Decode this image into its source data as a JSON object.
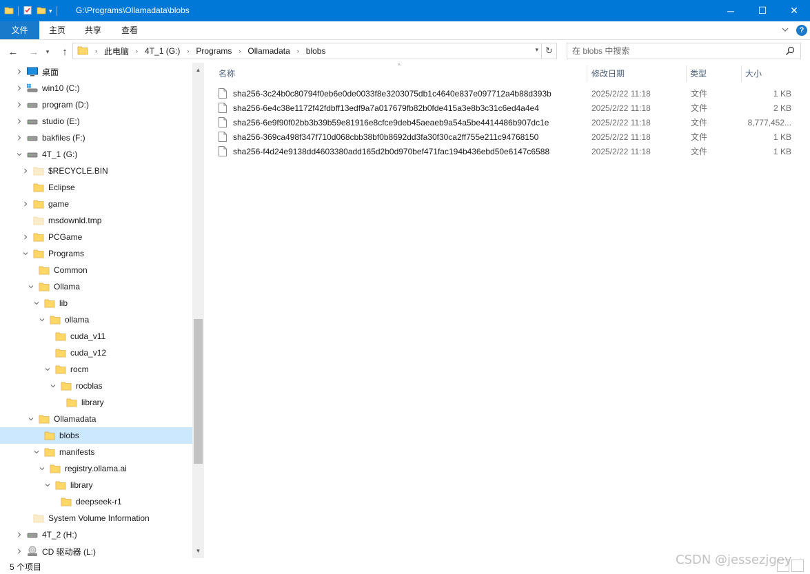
{
  "window": {
    "title": "G:\\Programs\\Ollamadata\\blobs",
    "min_glyph": "─",
    "max_glyph": "☐",
    "close_glyph": "✕"
  },
  "ribbon": {
    "file": "文件",
    "home": "主页",
    "share": "共享",
    "view": "查看",
    "help": "?"
  },
  "nav": {
    "back_glyph": "←",
    "fwd_glyph": "→",
    "recent_glyph": "▾",
    "up_glyph": "↑",
    "refresh_glyph": "↻",
    "breadcrumb": [
      "此电脑",
      "4T_1 (G:)",
      "Programs",
      "Ollamadata",
      "blobs"
    ],
    "separator_glyph": "›"
  },
  "search": {
    "placeholder": "在 blobs 中搜索"
  },
  "tree": [
    {
      "label": "桌面",
      "icon": "desktop-icon",
      "indent": 0,
      "arrow": ">",
      "selected": false
    },
    {
      "label": "win10 (C:)",
      "icon": "windows-drive-icon",
      "indent": 0,
      "arrow": ">",
      "selected": false
    },
    {
      "label": "program (D:)",
      "icon": "drive-icon",
      "indent": 0,
      "arrow": ">",
      "selected": false
    },
    {
      "label": "studio (E:)",
      "icon": "drive-icon",
      "indent": 0,
      "arrow": ">",
      "selected": false
    },
    {
      "label": "bakfiles (F:)",
      "icon": "drive-icon",
      "indent": 0,
      "arrow": ">",
      "selected": false
    },
    {
      "label": "4T_1 (G:)",
      "icon": "drive-icon",
      "indent": 0,
      "arrow": "v",
      "selected": false
    },
    {
      "label": "$RECYCLE.BIN",
      "icon": "folder-faded-icon",
      "indent": 1,
      "arrow": ">",
      "selected": false
    },
    {
      "label": "Eclipse",
      "icon": "folder-icon",
      "indent": 1,
      "arrow": "",
      "selected": false
    },
    {
      "label": "game",
      "icon": "folder-icon",
      "indent": 1,
      "arrow": ">",
      "selected": false
    },
    {
      "label": "msdownld.tmp",
      "icon": "folder-faded-icon",
      "indent": 1,
      "arrow": "",
      "selected": false
    },
    {
      "label": "PCGame",
      "icon": "folder-icon",
      "indent": 1,
      "arrow": ">",
      "selected": false
    },
    {
      "label": "Programs",
      "icon": "folder-icon",
      "indent": 1,
      "arrow": "v",
      "selected": false
    },
    {
      "label": "Common",
      "icon": "folder-icon",
      "indent": 2,
      "arrow": "",
      "selected": false
    },
    {
      "label": "Ollama",
      "icon": "folder-icon",
      "indent": 2,
      "arrow": "v",
      "selected": false
    },
    {
      "label": "lib",
      "icon": "folder-icon",
      "indent": 3,
      "arrow": "v",
      "selected": false
    },
    {
      "label": "ollama",
      "icon": "folder-icon",
      "indent": 4,
      "arrow": "v",
      "selected": false
    },
    {
      "label": "cuda_v11",
      "icon": "folder-icon",
      "indent": 5,
      "arrow": "",
      "selected": false
    },
    {
      "label": "cuda_v12",
      "icon": "folder-icon",
      "indent": 5,
      "arrow": "",
      "selected": false
    },
    {
      "label": "rocm",
      "icon": "folder-icon",
      "indent": 5,
      "arrow": "v",
      "selected": false
    },
    {
      "label": "rocblas",
      "icon": "folder-icon",
      "indent": 6,
      "arrow": "v",
      "selected": false
    },
    {
      "label": "library",
      "icon": "folder-icon",
      "indent": 7,
      "arrow": "",
      "selected": false
    },
    {
      "label": "Ollamadata",
      "icon": "folder-icon",
      "indent": 2,
      "arrow": "v",
      "selected": false
    },
    {
      "label": "blobs",
      "icon": "folder-icon",
      "indent": 3,
      "arrow": "",
      "selected": true
    },
    {
      "label": "manifests",
      "icon": "folder-icon",
      "indent": 3,
      "arrow": "v",
      "selected": false
    },
    {
      "label": "registry.ollama.ai",
      "icon": "folder-icon",
      "indent": 4,
      "arrow": "v",
      "selected": false
    },
    {
      "label": "library",
      "icon": "folder-icon",
      "indent": 5,
      "arrow": "v",
      "selected": false
    },
    {
      "label": "deepseek-r1",
      "icon": "folder-icon",
      "indent": 6,
      "arrow": "",
      "selected": false
    },
    {
      "label": "System Volume Information",
      "icon": "folder-faded-icon",
      "indent": 1,
      "arrow": "",
      "selected": false
    },
    {
      "label": "4T_2 (H:)",
      "icon": "drive-icon",
      "indent": 0,
      "arrow": ">",
      "selected": false
    },
    {
      "label": "CD 驱动器 (L:)",
      "icon": "cd-drive-icon",
      "indent": 0,
      "arrow": ">",
      "selected": false
    }
  ],
  "columns": {
    "name": "名称",
    "date": "修改日期",
    "type": "类型",
    "size": "大小"
  },
  "files": [
    {
      "name": "sha256-3c24b0c80794f0eb6e0de0033f8e3203075db1c4640e837e097712a4b88d393b",
      "date": "2025/2/22 11:18",
      "type": "文件",
      "size": "1 KB"
    },
    {
      "name": "sha256-6e4c38e1172f42fdbff13edf9a7a017679fb82b0fde415a3e8b3c31c6ed4a4e4",
      "date": "2025/2/22 11:18",
      "type": "文件",
      "size": "2 KB"
    },
    {
      "name": "sha256-6e9f90f02bb3b39b59e81916e8cfce9deb45aeaeb9a54a5be4414486b907dc1e",
      "date": "2025/2/22 11:18",
      "type": "文件",
      "size": "8,777,452..."
    },
    {
      "name": "sha256-369ca498f347f710d068cbb38bf0b8692dd3fa30f30ca2ff755e211c94768150",
      "date": "2025/2/22 11:18",
      "type": "文件",
      "size": "1 KB"
    },
    {
      "name": "sha256-f4d24e9138dd4603380add165d2b0d970bef471fac194b436ebd50e6147c6588",
      "date": "2025/2/22 11:18",
      "type": "文件",
      "size": "1 KB"
    }
  ],
  "status": {
    "count": "5 个项目"
  },
  "watermark": "CSDN @jessezjgey",
  "colors": {
    "titlebar": "#0078d7",
    "file_tab": "#1979ca",
    "selection": "#cce8ff",
    "folder": "#ffd767"
  }
}
